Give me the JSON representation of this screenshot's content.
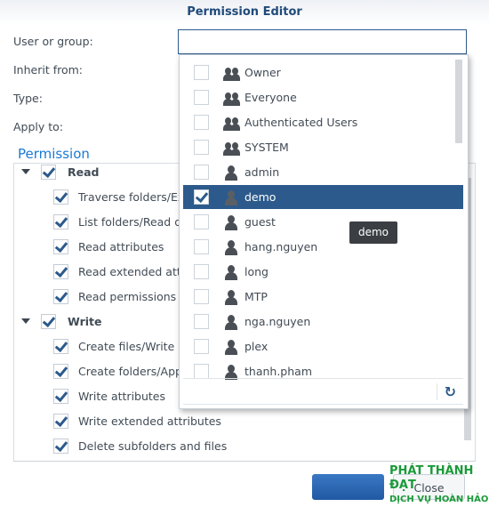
{
  "dialog": {
    "title": "Permission Editor"
  },
  "form": {
    "user_label": "User or group:",
    "inherit_label": "Inherit from:",
    "type_label": "Type:",
    "apply_label": "Apply to:",
    "user_value": ""
  },
  "permission": {
    "title": "Permission",
    "groups": [
      {
        "label": "Read",
        "checked": true,
        "items": [
          {
            "label": "Traverse folders/Ex",
            "checked": true
          },
          {
            "label": "List folders/Read d",
            "checked": true
          },
          {
            "label": "Read attributes",
            "checked": true
          },
          {
            "label": "Read extended att",
            "checked": true
          },
          {
            "label": "Read permissions",
            "checked": true
          }
        ]
      },
      {
        "label": "Write",
        "checked": true,
        "items": [
          {
            "label": "Create files/Write d",
            "checked": true
          },
          {
            "label": "Create folders/App",
            "checked": true
          },
          {
            "label": "Write attributes",
            "checked": true
          },
          {
            "label": "Write extended attributes",
            "checked": true
          },
          {
            "label": "Delete subfolders and files",
            "checked": true
          }
        ]
      }
    ]
  },
  "dropdown": {
    "items": [
      {
        "label": "Owner",
        "type": "group",
        "checked": false
      },
      {
        "label": "Everyone",
        "type": "group",
        "checked": false
      },
      {
        "label": "Authenticated Users",
        "type": "group",
        "checked": false
      },
      {
        "label": "SYSTEM",
        "type": "group",
        "checked": false
      },
      {
        "label": "admin",
        "type": "user",
        "checked": false
      },
      {
        "label": "demo",
        "type": "user",
        "checked": true,
        "selected": true
      },
      {
        "label": "guest",
        "type": "user",
        "checked": false
      },
      {
        "label": "hang.nguyen",
        "type": "user",
        "checked": false
      },
      {
        "label": "long",
        "type": "user",
        "checked": false
      },
      {
        "label": "MTP",
        "type": "user",
        "checked": false
      },
      {
        "label": "nga.nguyen",
        "type": "user",
        "checked": false
      },
      {
        "label": "plex",
        "type": "user",
        "checked": false
      },
      {
        "label": "thanh.pham",
        "type": "user",
        "checked": false
      }
    ],
    "refresh_icon": "refresh-icon"
  },
  "tooltip": "demo",
  "buttons": {
    "ok": "",
    "close": "Close"
  },
  "watermark": {
    "line1": "PHÁT THÀNH ĐẠT",
    "line2": "DỊCH VỤ HOÀN HẢO"
  },
  "colors": {
    "accent": "#2c5a8c",
    "link": "#1a7ad4"
  }
}
